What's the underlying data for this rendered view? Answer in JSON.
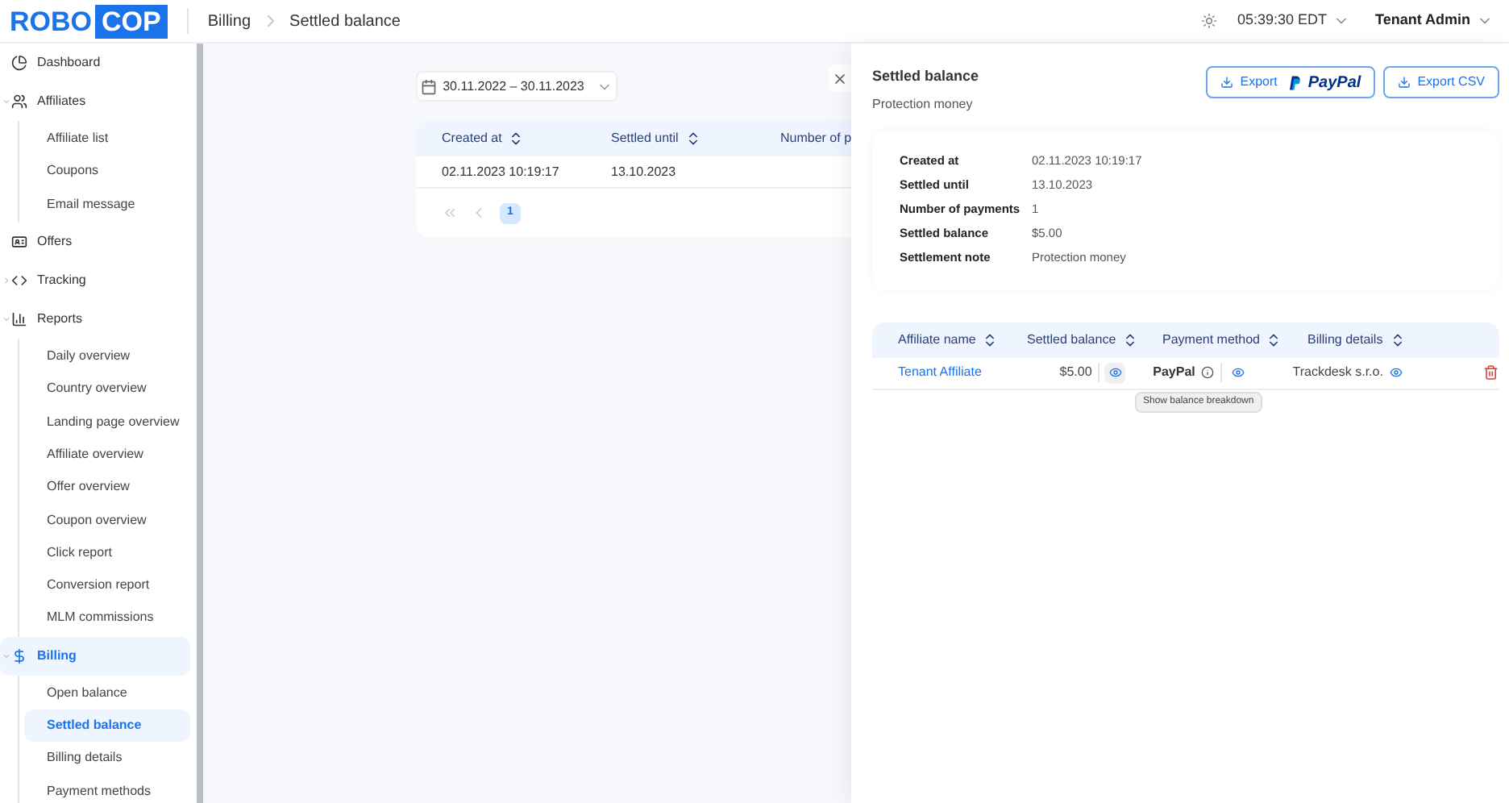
{
  "header": {
    "logo": {
      "part_1": "ROBO",
      "part_2": "COP"
    },
    "breadcrumbs": [
      "Billing",
      "Settled balance"
    ],
    "time": "05:39:30 EDT",
    "user": "Tenant Admin"
  },
  "sidebar": {
    "items": [
      {
        "label": "Dashboard",
        "selected": false
      },
      {
        "label": "Affiliates",
        "selected": false,
        "expanded": true,
        "children": [
          {
            "label": "Affiliate list",
            "selected": false
          },
          {
            "label": "Coupons",
            "selected": false
          },
          {
            "label": "Email message",
            "selected": false
          }
        ]
      },
      {
        "label": "Offers",
        "selected": false
      },
      {
        "label": "Tracking",
        "selected": false,
        "expanded": false
      },
      {
        "label": "Reports",
        "selected": false,
        "expanded": true,
        "children": [
          {
            "label": "Daily overview",
            "selected": false
          },
          {
            "label": "Country overview",
            "selected": false
          },
          {
            "label": "Landing page overview",
            "selected": false
          },
          {
            "label": "Affiliate overview",
            "selected": false
          },
          {
            "label": "Offer overview",
            "selected": false
          },
          {
            "label": "Coupon overview",
            "selected": false
          },
          {
            "label": "Click report",
            "selected": false
          },
          {
            "label": "Conversion report",
            "selected": false
          },
          {
            "label": "MLM commissions",
            "selected": false
          }
        ]
      },
      {
        "label": "Billing",
        "selected": true,
        "expanded": true,
        "children": [
          {
            "label": "Open balance",
            "selected": false
          },
          {
            "label": "Settled balance",
            "selected": true
          },
          {
            "label": "Billing details",
            "selected": false
          },
          {
            "label": "Payment methods",
            "selected": false
          }
        ]
      }
    ]
  },
  "main": {
    "date_range": "30.11.2022 – 30.11.2023",
    "table": {
      "columns": [
        "Created at",
        "Settled until",
        "Number of p"
      ],
      "rows": [
        [
          "02.11.2023 10:19:17",
          "13.10.2023"
        ]
      ]
    },
    "pagination": [
      {
        "label": "1",
        "selected": true
      }
    ]
  },
  "drawer": {
    "title": "Settled balance",
    "subtitle": "Protection money",
    "export_paypal": {
      "label": "Export",
      "brand": "PayPal"
    },
    "export_csv": {
      "label": "Export CSV"
    },
    "details": [
      {
        "label": "Created at",
        "value": "02.11.2023 10:19:17"
      },
      {
        "label": "Settled until",
        "value": "13.10.2023"
      },
      {
        "label": "Number of payments",
        "value": "1"
      },
      {
        "label": "Settled balance",
        "value": "$5.00"
      },
      {
        "label": "Settlement note",
        "value": "Protection money"
      }
    ],
    "table": {
      "columns": [
        "Affiliate name",
        "Settled balance",
        "Payment method",
        "Billing details"
      ],
      "rows": [
        {
          "affiliate": "Tenant Affiliate",
          "balance": "$5.00",
          "method": "PayPal",
          "billing": "Trackdesk s.r.o."
        }
      ]
    },
    "tooltip": "Show balance breakdown"
  }
}
